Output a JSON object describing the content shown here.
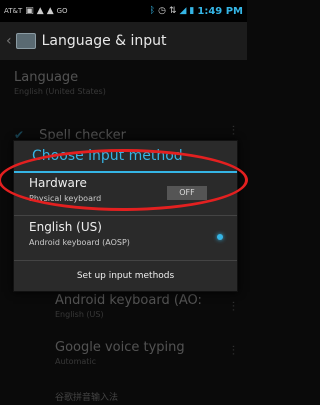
{
  "status_bar": {
    "carrier": "AT&T",
    "time": "1:49 PM"
  },
  "action_bar": {
    "title": "Language & input"
  },
  "background": {
    "language_title": "Language",
    "language_value": "English (United States)",
    "spell_checker": "Spell checker",
    "android_keyboard": "Android keyboard (AO:",
    "android_keyboard_sub": "English (US)",
    "google_voice": "Google voice typing",
    "google_voice_sub": "Automatic",
    "bottom_item": "谷歌拼音输入法"
  },
  "dialog": {
    "title": "Choose input method",
    "hardware": {
      "label": "Hardware",
      "sub": "Physical keyboard",
      "toggle": "OFF"
    },
    "english": {
      "label": "English (US)",
      "sub": "Android keyboard (AOSP)",
      "selected": true
    },
    "setup_button": "Set up input methods"
  },
  "colors": {
    "accent": "#35b5e5",
    "annotation": "#e32020"
  }
}
